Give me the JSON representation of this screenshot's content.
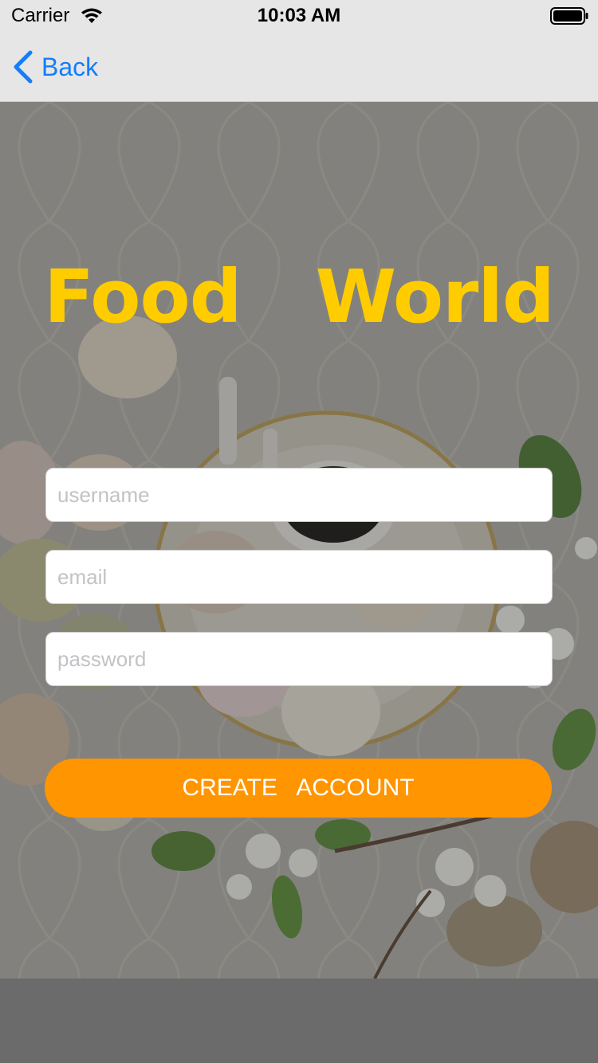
{
  "status_bar": {
    "carrier": "Carrier",
    "time": "10:03 AM",
    "icons": [
      "wifi-icon",
      "battery-icon"
    ]
  },
  "nav_bar": {
    "back_label": "Back",
    "back_icon": "chevron-left-icon",
    "tint_color": "#147efb"
  },
  "main": {
    "title": "Food   World",
    "title_color": "#ffcc00",
    "fields": {
      "username_placeholder": "username",
      "email_placeholder": "email",
      "password_placeholder": "password"
    },
    "create_button_label": "CREATE   ACCOUNT",
    "button_color": "#ff9500"
  }
}
